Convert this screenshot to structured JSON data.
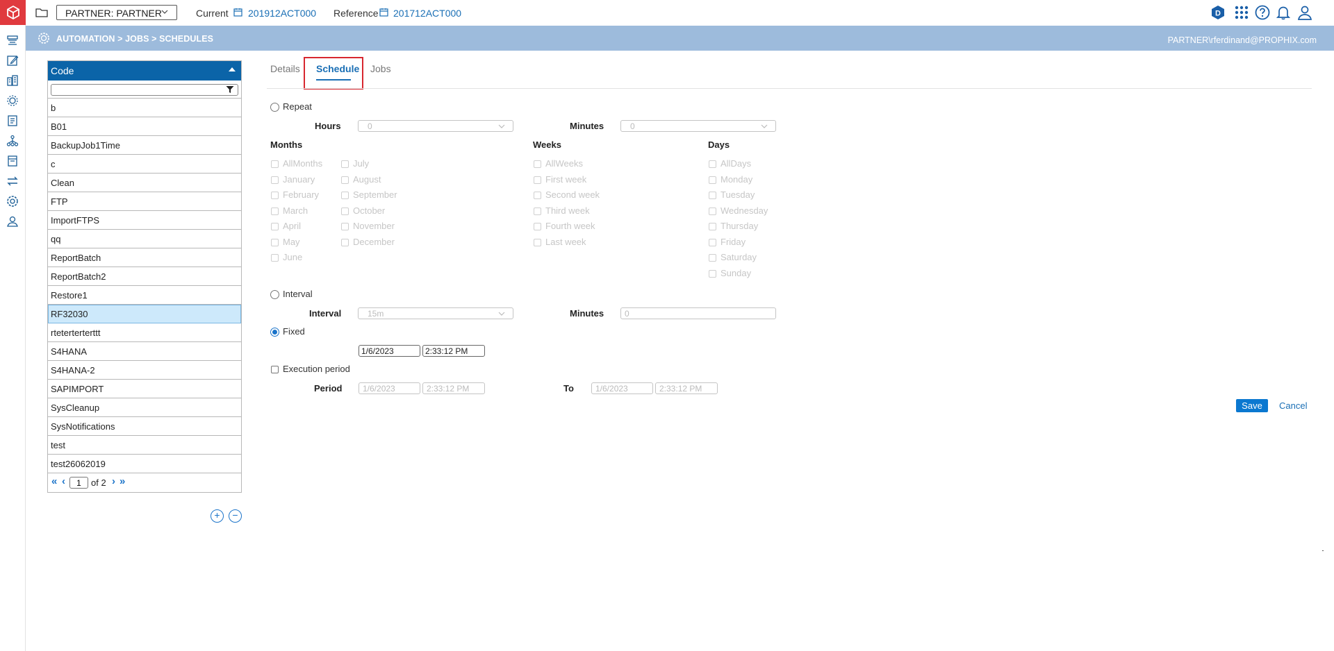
{
  "topbar": {
    "partner_select": "PARTNER: PARTNER",
    "current_label": "Current",
    "current_value": "201912ACT000",
    "reference_label": "Reference",
    "reference_value": "201712ACT000"
  },
  "band": {
    "breadcrumb": "AUTOMATION > JOBS > SCHEDULES",
    "user": "PARTNER\\rferdinand@PROPHIX.com"
  },
  "list": {
    "header": "Code",
    "filter_value": "",
    "items": [
      "b",
      "B01",
      "BackupJob1Time",
      "c",
      "Clean",
      "FTP",
      "ImportFTPS",
      "qq",
      "ReportBatch",
      "ReportBatch2",
      "Restore1",
      "RF32030",
      "rteterterterttt",
      "S4HANA",
      "S4HANA-2",
      "SAPIMPORT",
      "SysCleanup",
      "SysNotifications",
      "test",
      "test26062019"
    ],
    "selected_index": 11,
    "pager": {
      "first": "«",
      "prev": "‹",
      "page": "1",
      "of_label": "of 2",
      "next": "›",
      "last": "»"
    }
  },
  "tabs": [
    {
      "label": "Details",
      "active": false
    },
    {
      "label": "Schedule",
      "active": true
    },
    {
      "label": "Jobs",
      "active": false
    }
  ],
  "form": {
    "repeat_label": "Repeat",
    "hours_label": "Hours",
    "hours_value": "0",
    "minutes_label": "Minutes",
    "minutes_value": "0",
    "months_label": "Months",
    "months_col1": [
      "AllMonths",
      "January",
      "February",
      "March",
      "April",
      "May",
      "June"
    ],
    "months_col2": [
      "July",
      "August",
      "September",
      "October",
      "November",
      "December"
    ],
    "weeks_label": "Weeks",
    "weeks": [
      "AllWeeks",
      "First week",
      "Second week",
      "Third week",
      "Fourth week",
      "Last week"
    ],
    "days_label": "Days",
    "days": [
      "AllDays",
      "Monday",
      "Tuesday",
      "Wednesday",
      "Thursday",
      "Friday",
      "Saturday",
      "Sunday"
    ],
    "interval_radio_label": "Interval",
    "interval_label": "Interval",
    "interval_value": "15m",
    "interval_minutes_label": "Minutes",
    "interval_minutes_value": "0",
    "fixed_label": "Fixed",
    "fixed_date": "1/6/2023",
    "fixed_time": "2:33:12 PM",
    "exec_period_label": "Execution period",
    "period_label": "Period",
    "period_from_date": "1/6/2023",
    "period_from_time": "2:33:12 PM",
    "to_label": "To",
    "period_to_date": "1/6/2023",
    "period_to_time": "2:33:12 PM"
  },
  "actions": {
    "save": "Save",
    "cancel": "Cancel"
  },
  "colors": {
    "brand_red": "#e03a3e",
    "accent_blue": "#0b64a8",
    "band": "#9dbbdc",
    "highlight_border": "#d8272f"
  }
}
